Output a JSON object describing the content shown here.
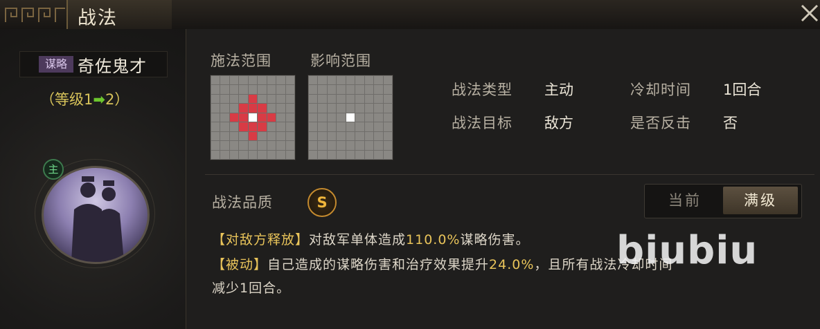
{
  "window": {
    "title": "战法"
  },
  "skill": {
    "type_badge": "谋略",
    "name": "奇佐鬼才",
    "level_open": "（等级1",
    "level_arrow": "➡",
    "level_close": "2）",
    "commander_badge": "主"
  },
  "ranges": {
    "cast_label": "施法范围",
    "effect_label": "影响范围"
  },
  "attributes": {
    "type_label": "战法类型",
    "type_value": "主动",
    "cooldown_label": "冷却时间",
    "cooldown_value": "1回合",
    "target_label": "战法目标",
    "target_value": "敌方",
    "counter_label": "是否反击",
    "counter_value": "否"
  },
  "quality": {
    "label": "战法品质",
    "grade": "S"
  },
  "toggle": {
    "current": "当前",
    "max": "满级",
    "selected": "满级"
  },
  "description": {
    "line1_tag": "【对敌方释放】",
    "line1_a": "对敌军单体造成",
    "line1_num": "110.0%",
    "line1_b": "谋略伤害。",
    "line2_tag": "【被动】",
    "line2_a": "自己造成的谋略伤害和治疗效果提升",
    "line2_num": "24.0%",
    "line2_b": "，且所有战法冷却时间",
    "line3": "减少1回合。"
  },
  "watermark": "biubiu",
  "colors": {
    "highlight": "#e9c45a",
    "range_hit": "#d83b45",
    "arrow": "#6cc62e"
  }
}
